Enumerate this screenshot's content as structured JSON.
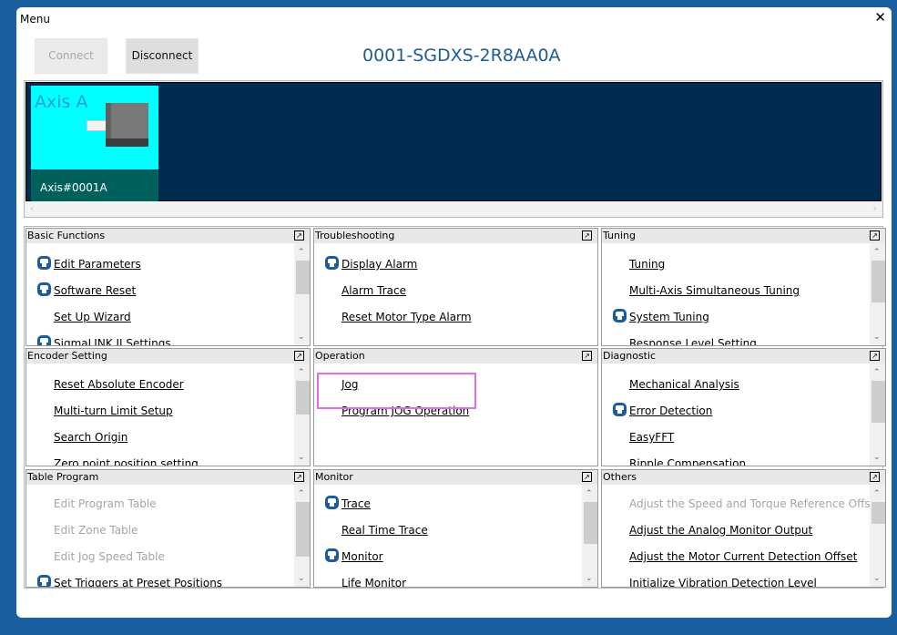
{
  "window": {
    "title": "Menu",
    "close_glyph": "✕"
  },
  "toolbar": {
    "connect_label": "Connect",
    "disconnect_label": "Disconnect"
  },
  "device": {
    "title": "0001-SGDXS-2R8AA0A"
  },
  "axis": {
    "name": "Axis A",
    "id": "Axis#0001A"
  },
  "scroll": {
    "left": "‹",
    "right": "›",
    "up": "⌃",
    "down": "⌄"
  },
  "panels": [
    {
      "title": "Basic Functions",
      "items": [
        {
          "label": "Edit Parameters",
          "icon": "save-icon",
          "enabled": true
        },
        {
          "label": "Software Reset",
          "icon": "save-icon",
          "enabled": true
        },
        {
          "label": "Set Up Wizard",
          "icon": null,
          "enabled": true
        },
        {
          "label": "SigmaLINK II Settings",
          "icon": "save-icon",
          "enabled": true
        }
      ]
    },
    {
      "title": "Troubleshooting",
      "items": [
        {
          "label": "Display Alarm",
          "icon": "save-icon",
          "enabled": true
        },
        {
          "label": "Alarm Trace",
          "icon": null,
          "enabled": true
        },
        {
          "label": "Reset Motor Type Alarm",
          "icon": null,
          "enabled": true
        }
      ]
    },
    {
      "title": "Tuning",
      "items": [
        {
          "label": "Tuning",
          "icon": null,
          "enabled": true
        },
        {
          "label": "Multi-Axis Simultaneous Tuning",
          "icon": null,
          "enabled": true
        },
        {
          "label": "System Tuning",
          "icon": "save-icon",
          "enabled": true
        },
        {
          "label": "Response Level Setting",
          "icon": null,
          "enabled": true
        }
      ]
    },
    {
      "title": "Encoder Setting",
      "items": [
        {
          "label": "Reset Absolute Encoder",
          "icon": null,
          "enabled": true
        },
        {
          "label": "Multi-turn Limit Setup",
          "icon": null,
          "enabled": true
        },
        {
          "label": "Search Origin",
          "icon": null,
          "enabled": true
        },
        {
          "label": "Zero point position setting",
          "icon": null,
          "enabled": true
        }
      ]
    },
    {
      "title": "Operation",
      "items": [
        {
          "label": "Jog",
          "icon": null,
          "enabled": true
        },
        {
          "label": "Program JOG Operation",
          "icon": null,
          "enabled": true
        }
      ]
    },
    {
      "title": "Diagnostic",
      "items": [
        {
          "label": "Mechanical Analysis",
          "icon": null,
          "enabled": true
        },
        {
          "label": "Error Detection",
          "icon": "save-icon",
          "enabled": true
        },
        {
          "label": "EasyFFT",
          "icon": null,
          "enabled": true
        },
        {
          "label": "Ripple Compensation",
          "icon": null,
          "enabled": true
        }
      ]
    },
    {
      "title": "Table Program",
      "items": [
        {
          "label": "Edit Program Table",
          "icon": null,
          "enabled": false
        },
        {
          "label": "Edit Zone Table",
          "icon": null,
          "enabled": false
        },
        {
          "label": "Edit Jog Speed Table",
          "icon": null,
          "enabled": false
        },
        {
          "label": "Set Triggers at Preset Positions",
          "icon": "save-icon",
          "enabled": true
        }
      ]
    },
    {
      "title": "Monitor",
      "items": [
        {
          "label": "Trace",
          "icon": "save-icon",
          "enabled": true
        },
        {
          "label": "Real Time Trace",
          "icon": null,
          "enabled": true
        },
        {
          "label": "Monitor",
          "icon": "save-icon",
          "enabled": true
        },
        {
          "label": "Life Monitor",
          "icon": null,
          "enabled": true
        }
      ]
    },
    {
      "title": "Others",
      "items": [
        {
          "label": "Adjust the Speed and Torque Reference Offset",
          "icon": null,
          "enabled": false
        },
        {
          "label": "Adjust the Analog Monitor Output",
          "icon": null,
          "enabled": true
        },
        {
          "label": "Adjust the Motor Current Detection Offset",
          "icon": null,
          "enabled": true
        },
        {
          "label": "Initialize Vibration Detection Level",
          "icon": null,
          "enabled": true
        }
      ]
    }
  ]
}
